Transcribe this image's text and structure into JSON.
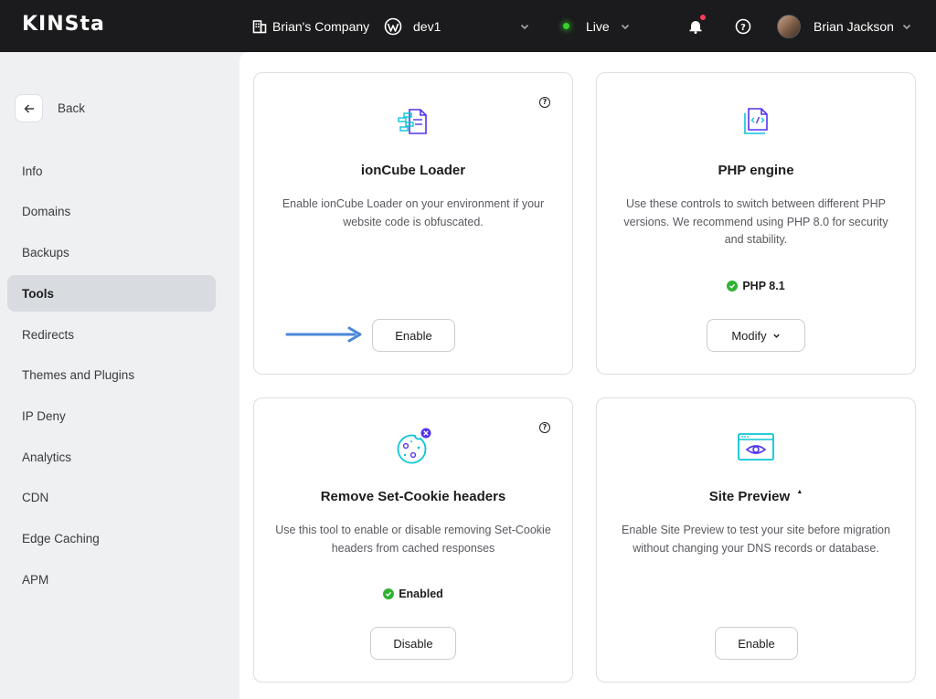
{
  "topbar": {
    "logo": "KINSta",
    "company": "Brian's Company",
    "site": "dev1",
    "environment": "Live",
    "user": "Brian Jackson"
  },
  "sidebar": {
    "back_label": "Back",
    "items": [
      {
        "label": "Info",
        "active": false
      },
      {
        "label": "Domains",
        "active": false
      },
      {
        "label": "Backups",
        "active": false
      },
      {
        "label": "Tools",
        "active": true
      },
      {
        "label": "Redirects",
        "active": false
      },
      {
        "label": "Themes and Plugins",
        "active": false
      },
      {
        "label": "IP Deny",
        "active": false
      },
      {
        "label": "Analytics",
        "active": false
      },
      {
        "label": "CDN",
        "active": false
      },
      {
        "label": "Edge Caching",
        "active": false
      },
      {
        "label": "APM",
        "active": false
      }
    ]
  },
  "cards": {
    "ioncube": {
      "title": "ionCube Loader",
      "description": "Enable ionCube Loader on your environment if your website code is obfuscated.",
      "button": "Enable",
      "icon": "ioncube-icon"
    },
    "php": {
      "title": "PHP engine",
      "description": "Use these controls to switch between different PHP versions. We recommend using PHP 8.0 for security and stability.",
      "status": "PHP 8.1",
      "button": "Modify",
      "icon": "php-code-icon"
    },
    "cookie": {
      "title": "Remove Set-Cookie headers",
      "description": "Use this tool to enable or disable removing Set-Cookie headers from cached responses",
      "status": "Enabled",
      "button": "Disable",
      "icon": "cookie-icon"
    },
    "preview": {
      "title": "Site Preview",
      "title_badge": "▲",
      "description": "Enable Site Preview to test your site before migration without changing your DNS records or database.",
      "button": "Enable",
      "icon": "eye-browser-icon"
    }
  },
  "colors": {
    "topbar": "#1b1b1d",
    "accent_purple": "#5333ed",
    "accent_cyan": "#0bc5d6",
    "status_green": "#2fb233",
    "arrow_blue": "#4a86d8"
  }
}
